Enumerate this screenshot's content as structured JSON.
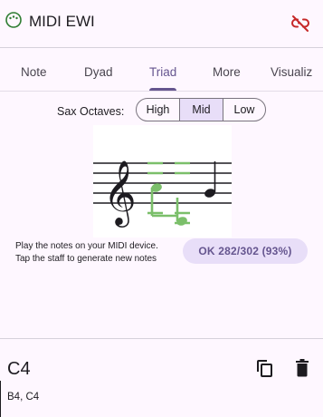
{
  "app": {
    "title": "MIDI EWI"
  },
  "tabs": [
    {
      "label": "Note"
    },
    {
      "label": "Dyad"
    },
    {
      "label": "Triad"
    },
    {
      "label": "More"
    },
    {
      "label": "Visualiz"
    }
  ],
  "active_tab": "Triad",
  "octaves": {
    "label": "Sax Octaves:",
    "options": [
      "High",
      "Mid",
      "Low"
    ],
    "selected": "Mid"
  },
  "staff": {
    "clef": "treble"
  },
  "status": {
    "line1": "Play the notes on your MIDI device.",
    "line2": "Tap the staff to generate new notes",
    "score": "OK 282/302 (93%)"
  },
  "bottom": {
    "note_name": "C4",
    "note_list": "B4, C4"
  },
  "icons": {
    "app": "piano-keys-icon",
    "connection": "link-off-icon",
    "copy": "copy-icon",
    "delete": "trash-icon"
  },
  "colors": {
    "accent": "#65558f",
    "chip_bg": "#e8def8",
    "green": "#7bbf6a",
    "red": "#c62828",
    "logo_green": "#2e7d32",
    "background": "#fef7ff"
  }
}
